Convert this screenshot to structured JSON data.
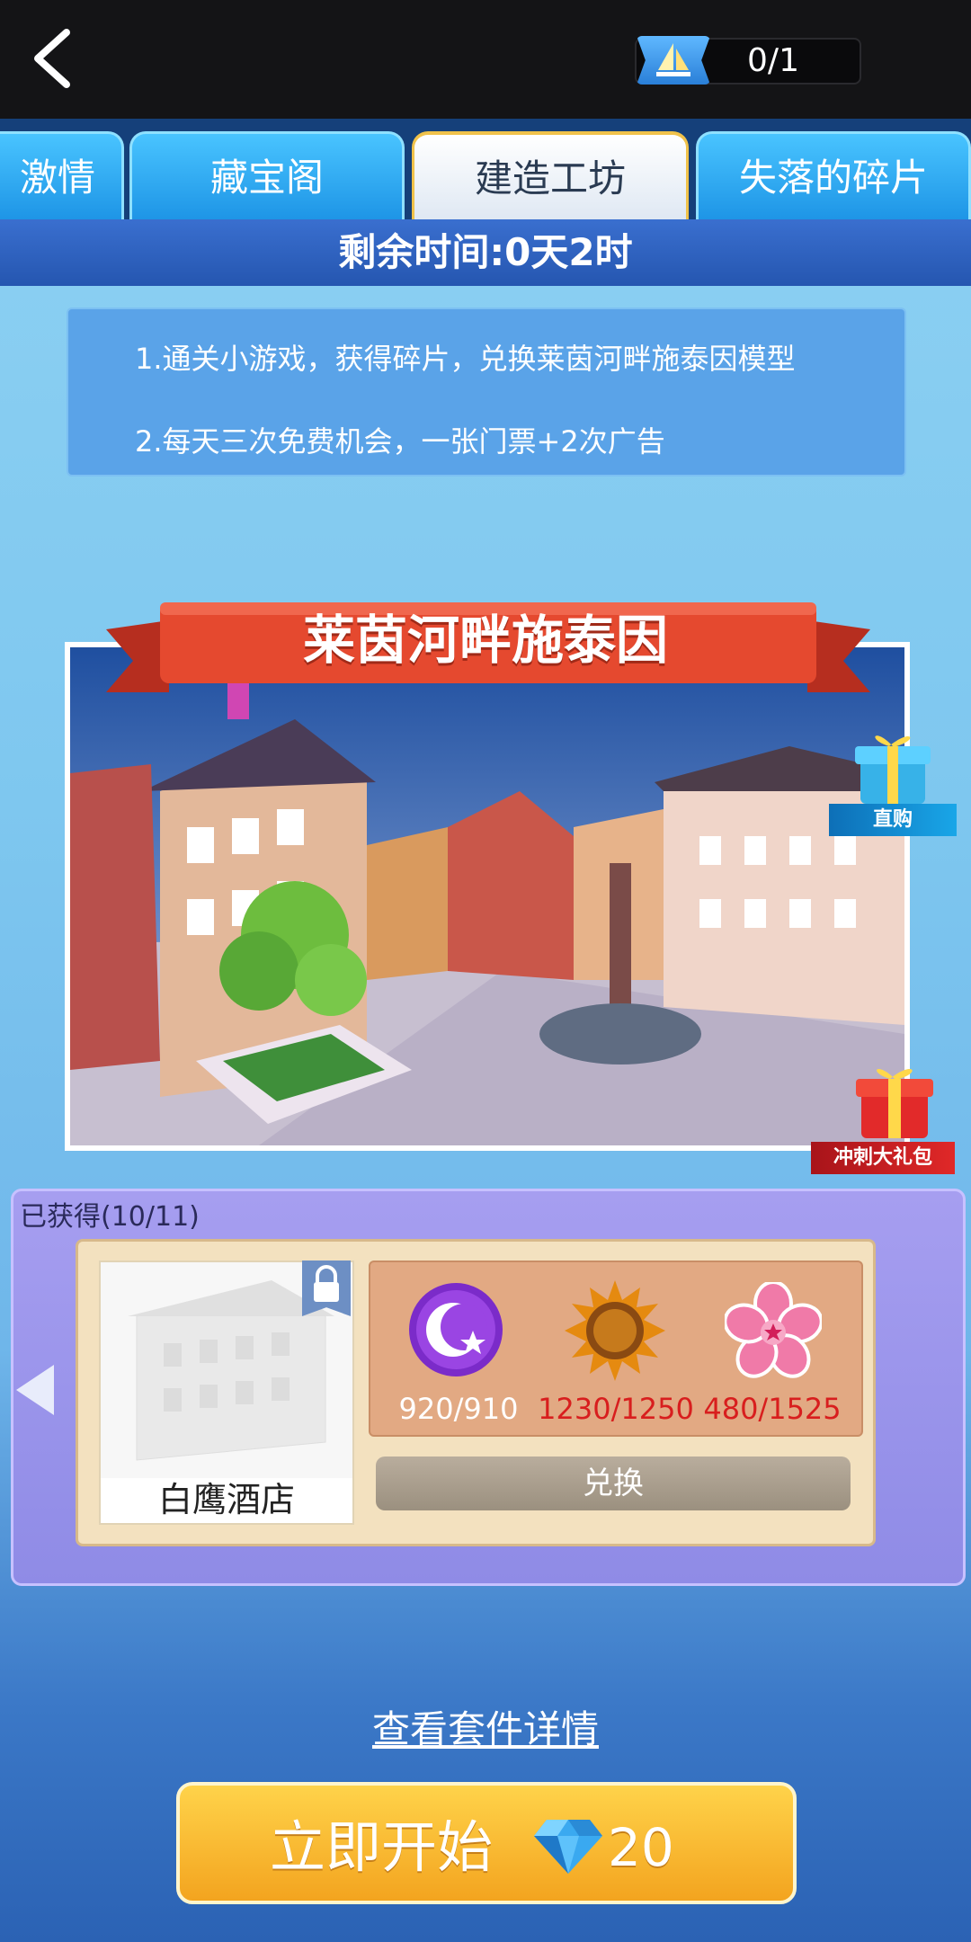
{
  "header": {
    "tickets": "0/1"
  },
  "tabs": [
    {
      "label": "激情"
    },
    {
      "label": "藏宝阁"
    },
    {
      "label": "建造工坊"
    },
    {
      "label": "失落的碎片"
    }
  ],
  "remaining_time": "剩余时间:0天2时",
  "info": {
    "line1": "1.通关小游戏，获得碎片，兑换莱茵河畔施泰因模型",
    "line2": "2.每天三次免费机会，一张门票+2次广告"
  },
  "scene": {
    "title": "莱茵河畔施泰因"
  },
  "gifts": {
    "direct_buy": "直购",
    "sprint_pack": "冲刺大礼包"
  },
  "collection": {
    "obtained": "已获得(10/11)",
    "building_name": "白鹰酒店",
    "resources": [
      {
        "icon": "moon-star-icon",
        "count": "920/910",
        "color": "#ffffff"
      },
      {
        "icon": "sun-icon",
        "count": "1230/1250",
        "color": "#d81e1e"
      },
      {
        "icon": "sakura-icon",
        "count": "480/1525",
        "color": "#d81e1e"
      }
    ],
    "exchange_label": "兑换"
  },
  "footer": {
    "details_link": "查看套件详情",
    "start_label": "立即开始",
    "start_cost": "20"
  }
}
